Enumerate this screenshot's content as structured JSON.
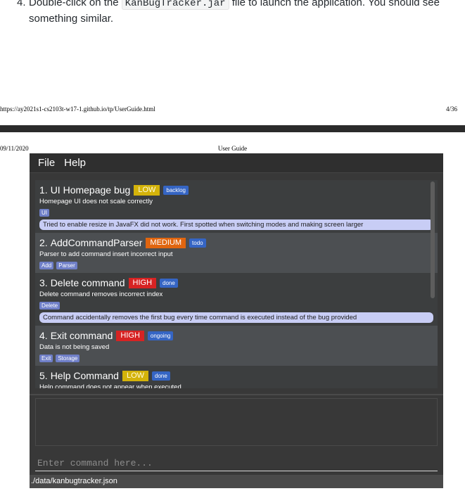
{
  "doc": {
    "step_number": "4.",
    "step_text_before": "Double-click on the",
    "step_code": "KanBugTracker.jar",
    "step_text_after": "file to launch the application. You should see",
    "step_text_line2": "something similar.",
    "footer_url": "https://ay2021s1-cs2103t-w17-1.github.io/tp/UserGuide.html",
    "footer_page": "4/36",
    "header_date": "09/11/2020",
    "header_title": "User Guide"
  },
  "app": {
    "menus": [
      "File",
      "Help"
    ],
    "bugs": [
      {
        "index": "1.",
        "name": "UI Homepage bug",
        "severity": "LOW",
        "severity_color": "#d4b30a",
        "state": "backlog",
        "description": "Homepage UI does not scale correctly",
        "tags": [
          "UI"
        ],
        "note": "Tried to enable resize in JavaFX did not work. First spotted when switching modes and making screen larger"
      },
      {
        "index": "2.",
        "name": "AddCommandParser",
        "severity": "MEDIUM",
        "severity_color": "#e0650f",
        "state": "todo",
        "description": "Parser to add command insert incorrect input",
        "tags": [
          "Add",
          "Parser"
        ],
        "note": ""
      },
      {
        "index": "3.",
        "name": "Delete command",
        "severity": "HIGH",
        "severity_color": "#d72323",
        "state": "done",
        "description": "Delete command removes incorrect index",
        "tags": [
          "Delete"
        ],
        "note": "Command accidentally removes the first bug every time command is executed instead of the bug provided"
      },
      {
        "index": "4.",
        "name": "Exit command",
        "severity": "HIGH",
        "severity_color": "#d72323",
        "state": "ongoing",
        "description": "Data is not being saved",
        "tags": [
          "Exit",
          "Storage"
        ],
        "note": ""
      },
      {
        "index": "5.",
        "name": "Help Command",
        "severity": "LOW",
        "severity_color": "#d4b30a",
        "state": "done",
        "description": "Help command does not appear when executed",
        "tags": [],
        "note": ""
      }
    ],
    "command_placeholder": "Enter command here...",
    "status_path": "./data/kanbugtracker.json"
  }
}
